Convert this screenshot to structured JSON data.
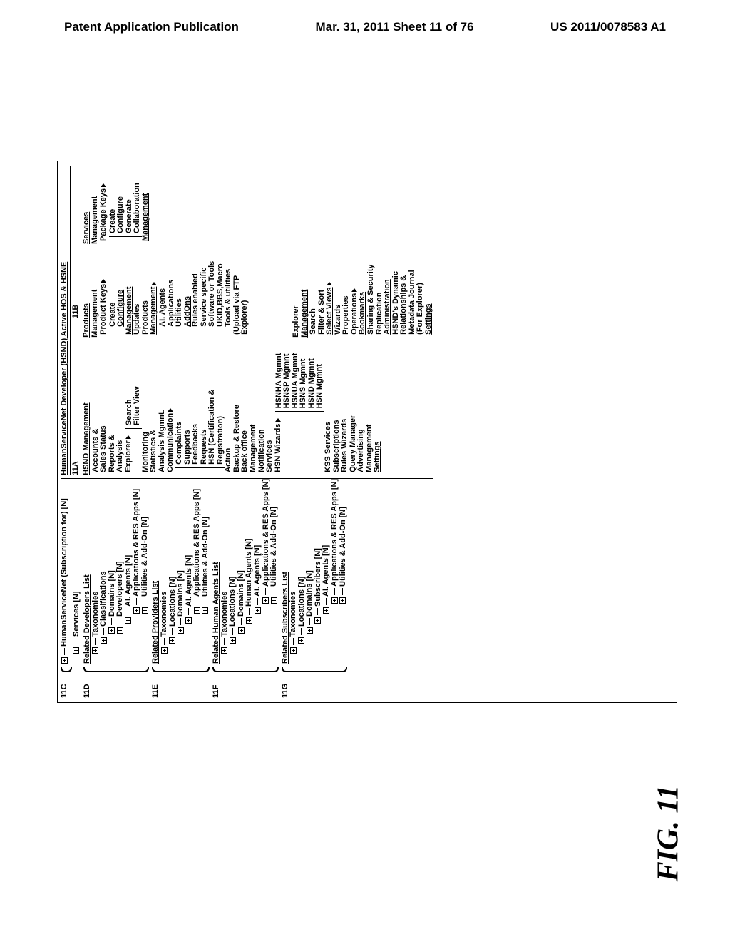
{
  "header": {
    "left": "Patent Application Publication",
    "center": "Mar. 31, 2011  Sheet 11 of 76",
    "right": "US 2011/0078583 A1"
  },
  "figure_label": "FIG. 11",
  "refs": {
    "c": "11C",
    "d": "11D",
    "e": "11E",
    "f": "11F",
    "g": "11G",
    "a": "11A",
    "b": "11B"
  },
  "tree": {
    "root": "HumanServiceNet (Subscription for) [N]",
    "services": "Services [N]",
    "rel_dev": "Related Developers List",
    "tax": "Taxonomies",
    "cls": "Classifications",
    "domains": "Domains [N]",
    "developers": "Developers [N]",
    "ai_agents": "AI. Agents [N]",
    "apps": "Applications & RES Apps [N]",
    "utils": "Utilities & Add-On [N]",
    "rel_prov": "Related Providers List",
    "locations": "Locations [N]",
    "rel_ha": "Related Human Agents List",
    "human_agents": "Human Agents [N]",
    "rel_sub": "Related Subscribers List",
    "subscribers": "Subscribers [N]"
  },
  "window_title": "HumanServiceNet Developer (HSND) Active HOS & HSNE",
  "menu": {
    "hsnd": {
      "title": "HSND Management",
      "items": {
        "accounts": "Accounts &",
        "sales": "Sales Status",
        "reports": "Reports &",
        "analysis": "Analysis",
        "explorer": "Explorer",
        "monitoring": "Monitoring",
        "stats": "Statistics &",
        "analysis_mgmt": "Analysis Mgmnt.",
        "comm": "Communication",
        "action": "Action",
        "backup": "Backup & Restore",
        "backoffice": "Back office",
        "mgmt": "Management",
        "notif": "Notification",
        "services": "Services",
        "hsn_wiz": "HSN Wizards",
        "kss": "KSS Services",
        "subs": "Subscriptions",
        "rules_wiz": "Rules Wizards",
        "query": "Query Manager",
        "adv": "Advertising",
        "mgmt2": "Management",
        "settings": "Settings"
      },
      "fly1": {
        "search": "Search",
        "filter": "Filter View"
      },
      "fly2": {
        "complaints": "Complaints",
        "supports": "Supports",
        "feedbacks": "Feedbacks",
        "requests": "Requests",
        "cert": "HSN (Certification & Registration)"
      },
      "fly3": {
        "hsnha": "HSNHA Mgmnt",
        "hsnsp": "HSNSP Mgmnt",
        "hsnua": "HSNUA Mgmnt",
        "hsns": "HSNS Mgmnt",
        "hsnd": "HSND Mgmnt",
        "hsn": "HSN Mgmnt"
      }
    },
    "products": {
      "title": "Products Management",
      "keys": "Product Keys",
      "keys_mgmt": "Management",
      "updates": "Updates",
      "prods": "Products",
      "prods_mgmt": "Management",
      "upload": "(Upload via FTP Explorer)",
      "create": "Create",
      "configure": "Configure",
      "fly": {
        "ai": "AI. Agents",
        "apps": "Applications",
        "utils": "Utilities",
        "addons": "AddOns",
        "rules": "Rules enabled",
        "svc": "Service specific",
        "sw": "Software or Tools",
        "ukid": "UKID,BBS,Macro",
        "tools": "Tools & utilities"
      }
    },
    "services": {
      "title": "Services Management",
      "keys": "Package Keys",
      "keys_mgmt": "Management",
      "create": "Create",
      "configure": "Configure",
      "generate": "Generate",
      "collab": "Collaboration"
    },
    "explorer": {
      "title": "Explorer Management",
      "search": "Search",
      "filter": "Filter & Sort",
      "views": "Select Views",
      "wizards": "Wizards",
      "props": "Properties",
      "ops": "Operations",
      "bookmarks": "Bookmarks",
      "sharing": "Sharing & Security",
      "repl": "Replication",
      "admin": "Administration",
      "dyn": "HSND's Dynamic",
      "rel": "Relationships &",
      "meta": "Metadata Journal",
      "for_exp": "(For Explorer)",
      "settings": "Settings"
    }
  }
}
